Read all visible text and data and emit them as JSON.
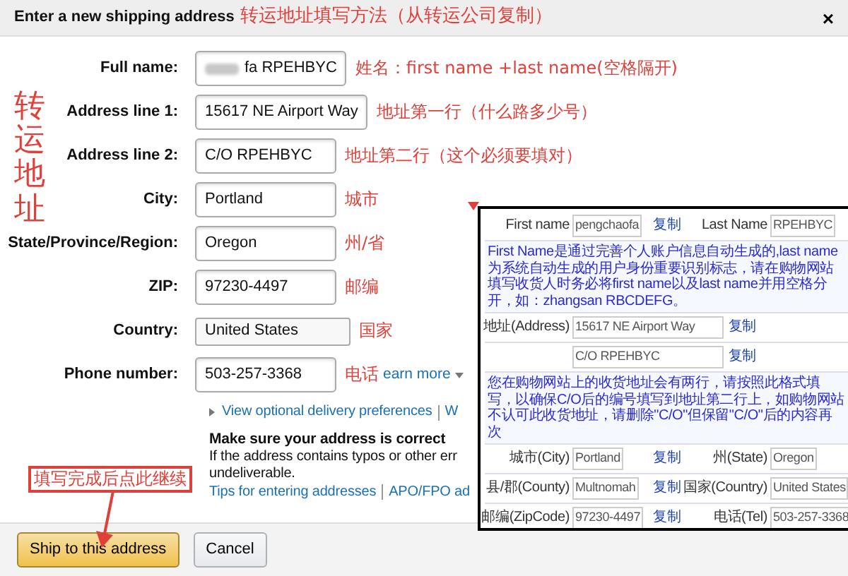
{
  "header": {
    "title": "Enter a new shipping address",
    "annotation": "转运地址填写方法（从转运公司复制）",
    "close": "×"
  },
  "side_annotation": "转运地址",
  "fields": [
    {
      "kind": "text",
      "label": "Full name:",
      "value": "fa RPEHBYC",
      "redacted": true,
      "annotation": "姓名：first name +last name(空格隔开)"
    },
    {
      "kind": "text",
      "label": "Address line 1:",
      "value": "15617 NE Airport Way",
      "annotation": "地址第一行（什么路多少号）"
    },
    {
      "kind": "text",
      "label": "Address line 2:",
      "value": "C/O  RPEHBYC",
      "annotation": "地址第二行（这个必须要填对）"
    },
    {
      "kind": "text",
      "label": "City:",
      "value": "Portland",
      "annotation": "城市"
    },
    {
      "kind": "text",
      "label": "State/Province/Region:",
      "value": "Oregon",
      "annotation": "州/省"
    },
    {
      "kind": "text",
      "label": "ZIP:",
      "value": "97230-4497",
      "annotation": "邮编"
    },
    {
      "kind": "select",
      "label": "Country:",
      "value": "United States",
      "annotation": "国家"
    },
    {
      "kind": "text",
      "label": "Phone number:",
      "value": "503-257-3368",
      "annotation": "电话",
      "link": "earn more"
    }
  ],
  "links": [
    "View optional delivery preferences",
    "W"
  ],
  "notice": {
    "title": "Make sure your address is correct",
    "lines": [
      "If the address contains typos or other err",
      "undeliverable."
    ],
    "links": [
      "Tips for entering addresses",
      "APO/FPO ad"
    ]
  },
  "buttons": [
    {
      "label": "Ship to this address",
      "kind": "primary"
    },
    {
      "label": "Cancel",
      "kind": "secondary"
    }
  ],
  "button_annotation": "填写完成后点此继续",
  "inset": {
    "rows": [
      {
        "kind": "pair",
        "label": "First name",
        "value": "pengchaofa",
        "copy": "复制",
        "label2": "Last Name",
        "value2": "RPEHBYC"
      },
      {
        "kind": "note",
        "text": "First Name是通过完善个人账户信息自动生成的,last name为系统自动生成的用户身份重要识别标志，请在购物网站填写收货人时务必将first name以及last name并用空格分开，如：zhangsan RBCDEFG。"
      },
      {
        "kind": "single",
        "label": "地址(Address)",
        "value": "15617 NE Airport Way",
        "copy": "复制"
      },
      {
        "kind": "single",
        "value": "C/O RPEHBYC",
        "copy": "复制"
      },
      {
        "kind": "note",
        "text": "您在购物网站上的收货地址会有两行，请按照此格式填写，以确保C/O后的编号填写到地址第二行上，如购物网站不认可此收货地址，请删除\"C/O\"但保留\"C/O\"后的内容再次"
      },
      {
        "kind": "pair",
        "label": "城市(City)",
        "value": "Portland",
        "copy": "复制",
        "label2": "州(State)",
        "value2": "Oregon"
      },
      {
        "kind": "pair",
        "label": "县/郡(County)",
        "value": "Multnomah",
        "copy": "复制",
        "label2": "国家(Country)",
        "value2": "United States"
      },
      {
        "kind": "pair",
        "label": "邮编(ZipCode)",
        "value": "97230-4497",
        "copy": "复制",
        "label2": "电话(Tel)",
        "value2": "503-257-3368"
      }
    ]
  }
}
